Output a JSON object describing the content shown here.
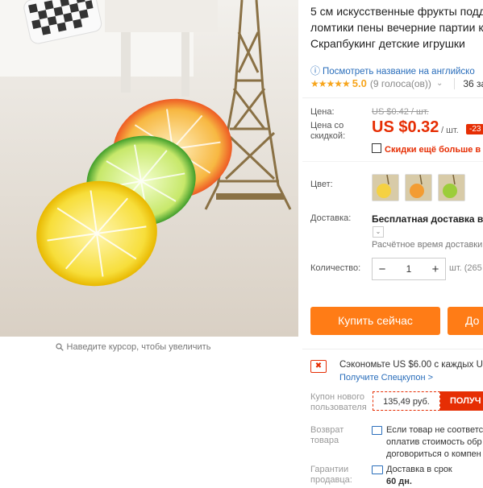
{
  "product": {
    "title_lines": [
      "5 см искусственные фрукты подде",
      "ломтики пены вечерние партии к",
      "Скрапбукинг детские игрушки"
    ],
    "translate_link": "Посмотреть название на английско",
    "rating": {
      "stars": "★★★★★",
      "value": "5.0",
      "votes": "(9 голоса(ов))",
      "orders": "36 за"
    }
  },
  "image": {
    "zoom_hint": "Наведите курсор, чтобы увеличить"
  },
  "price": {
    "label": "Цена:",
    "old": "US $0.42 / шт.",
    "sale_label": "Цена со скидкой:",
    "current": "US $0.32",
    "unit": "/ шт.",
    "discount": "-23",
    "coupon_note": "Скидки ещё больше в п"
  },
  "options": {
    "color_label": "Цвет:",
    "swatch_colors": [
      "#f5d142",
      "#f39c32",
      "#9ccd3a"
    ],
    "shipping_label": "Доставка:",
    "shipping_free": "Бесплатная доставка в Ru",
    "shipping_chevron": "⌄",
    "shipping_time": "Расчётное время доставки",
    "qty_label": "Количество:",
    "qty_minus": "−",
    "qty_value": "1",
    "qty_plus": "+",
    "qty_available": "шт. (265"
  },
  "actions": {
    "buy_now": "Купить сейчас",
    "add_to_cart": "До"
  },
  "coupons": {
    "save_icon": "✖",
    "save_text": "Сэкономьте US $6.00 с каждых US",
    "get_coupon": "Получите Спецкупон >",
    "new_user_label": "Купон нового пользователя",
    "new_user_amount": "135,49 руб.",
    "new_user_get": "ПОЛУЧ"
  },
  "protection": {
    "return_label": "Возврат товара",
    "return_lines": [
      "Если товар не соответс",
      "оплатив стоимость обр",
      "договориться о компен"
    ],
    "guarantee_label": "Гарантии продавца:",
    "guarantee_text": "Доставка в срок",
    "guarantee_days": "60 дн."
  },
  "colors": {
    "accent": "#e62e04",
    "button": "#ff7c16",
    "link": "#2a6ebb",
    "star": "#f7a51c"
  }
}
